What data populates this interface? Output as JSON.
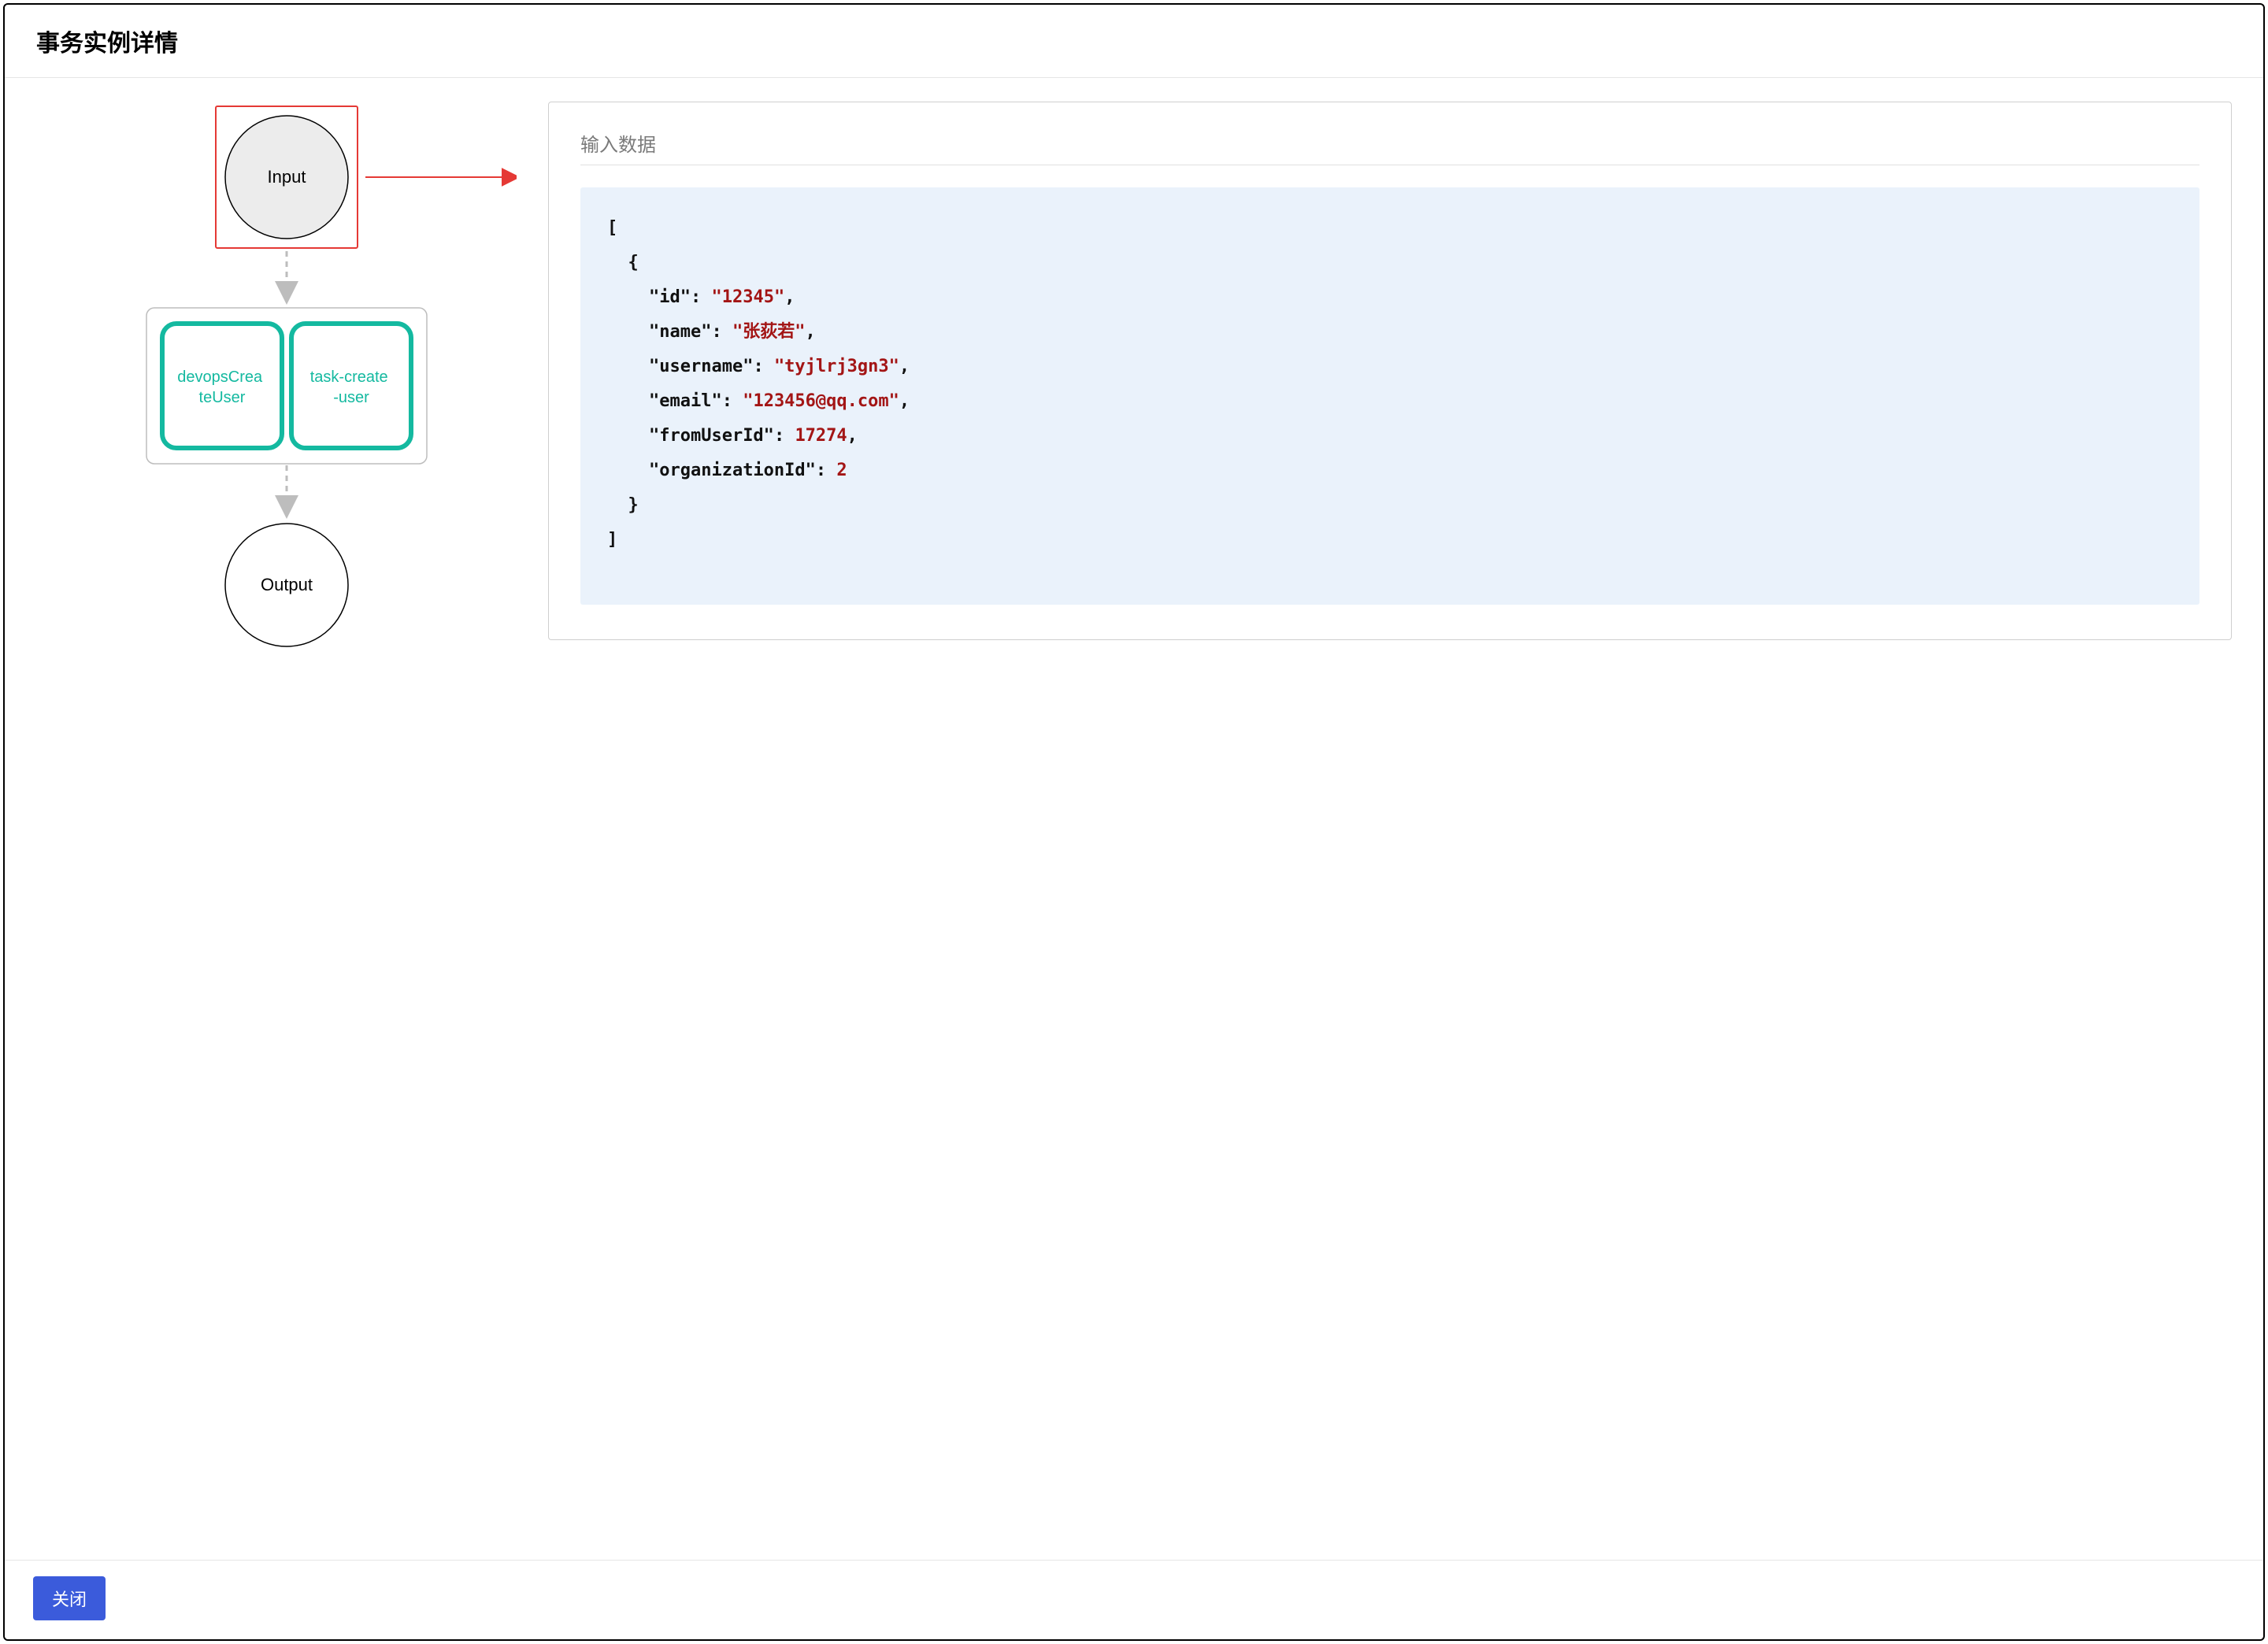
{
  "header": {
    "title": "事务实例详情"
  },
  "diagram": {
    "input_label": "Input",
    "output_label": "Output",
    "tasks": [
      {
        "label": "devopsCreateUser"
      },
      {
        "label": "task-create-user"
      }
    ]
  },
  "detail": {
    "section_title": "输入数据",
    "payload": [
      {
        "id": "12345",
        "name": "张荻若",
        "username": "tyjlrj3gn3",
        "email": "123456@qq.com",
        "fromUserId": 17274,
        "organizationId": 2
      }
    ]
  },
  "footer": {
    "close_label": "关闭"
  },
  "colors": {
    "selected_border": "#e53935",
    "task_border": "#14b9a0",
    "task_text": "#14b9a0",
    "arrow_gray": "#bdbdbd",
    "arrow_red": "#e53935"
  }
}
